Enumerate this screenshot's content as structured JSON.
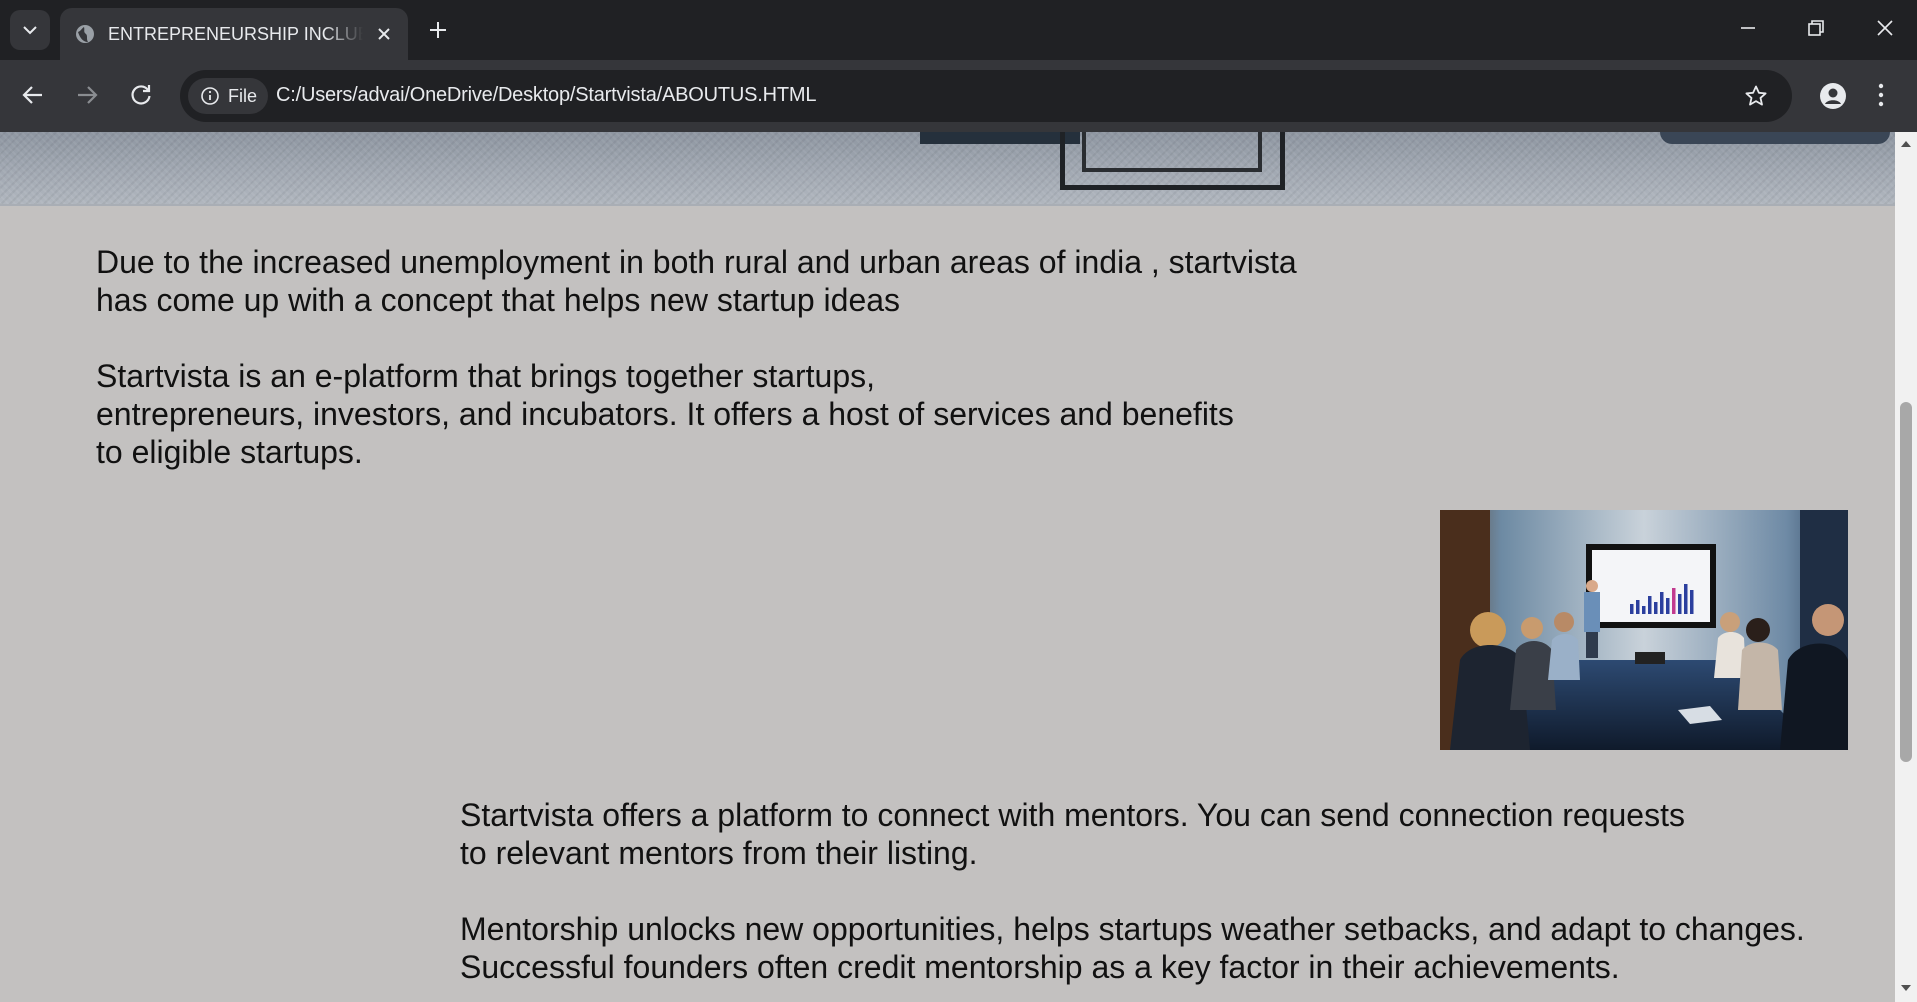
{
  "browser": {
    "tab_title": "ENTREPRENEURSHIP INCLUBLA",
    "site_info_label": "File",
    "url": "C:/Users/advai/OneDrive/Desktop/Startvista/ABOUTUS.HTML"
  },
  "page": {
    "paragraphs": [
      "Due to the increased unemployment in both rural and urban areas of india , startvista\nhas come up with a concept that helps new startup ideas",
      "Startvista is an e-platform that brings together startups,\nentrepreneurs, investors, and incubators. It offers a host of services and benefits\nto eligible startups.",
      "Startvista offers a platform to connect with mentors. You can send connection requests\nto relevant mentors from their listing.",
      "Mentorship unlocks new opportunities, helps startups weather setbacks, and adapt to changes.\nSuccessful founders often credit mentorship as a key factor in their achievements."
    ]
  },
  "chart_in_photo": {
    "colors": {
      "bars": "#2b3f9e",
      "accent_bar": "#c23a8f",
      "screen_bg": "#f4f5f8"
    }
  }
}
